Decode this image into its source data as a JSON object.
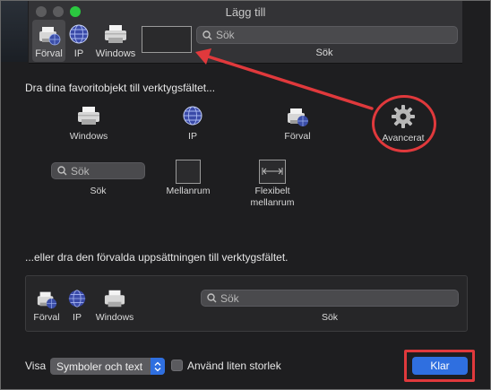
{
  "window": {
    "title": "Lägg till",
    "traffic_lights": [
      "#5c5c5e",
      "#5c5c5e",
      "#2bc840"
    ]
  },
  "toolbar": {
    "items": [
      {
        "label": "Förval",
        "icon": "printer-globe-icon"
      },
      {
        "label": "IP",
        "icon": "globe-icon"
      },
      {
        "label": "Windows",
        "icon": "printer-icon"
      }
    ],
    "search_placeholder": "Sök",
    "search_label": "Sök"
  },
  "palette": {
    "heading": "Dra dina favoritobjekt till verktygsfältet...",
    "items": [
      {
        "label": "Windows",
        "icon": "printer-icon"
      },
      {
        "label": "IP",
        "icon": "globe-icon"
      },
      {
        "label": "Förval",
        "icon": "printer-globe-icon"
      },
      {
        "label": "Avancerat",
        "icon": "gear-icon"
      }
    ],
    "search_placeholder": "Sök",
    "search_label": "Sök",
    "space_label": "Mellanrum",
    "flexible_space_label_line1": "Flexibelt",
    "flexible_space_label_line2": "mellanrum"
  },
  "default_set": {
    "heading": "...eller dra den förvalda uppsättningen till verktygsfältet.",
    "items": [
      {
        "label": "Förval",
        "icon": "printer-globe-icon"
      },
      {
        "label": "IP",
        "icon": "globe-icon"
      },
      {
        "label": "Windows",
        "icon": "printer-icon"
      }
    ],
    "search_placeholder": "Sök",
    "search_label": "Sök"
  },
  "footer": {
    "show_label": "Visa",
    "show_value": "Symboler och text",
    "small_size_label": "Använd liten storlek",
    "done_button": "Klar"
  },
  "colors": {
    "annotation": "#e0393c",
    "accent": "#2f6fe0"
  }
}
